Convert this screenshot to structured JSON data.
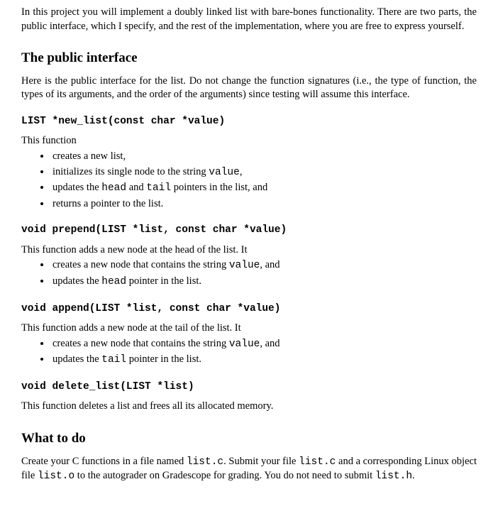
{
  "intro": {
    "p1": "In this project you will implement a doubly linked list with bare-bones functionality. There are two parts, the public interface, which I specify, and the rest of the implementation, where you are free to express yourself."
  },
  "section_public": {
    "heading": "The public interface",
    "p1": "Here is the public interface for the list. Do not change the function signatures (i.e., the type of function, the types of its arguments, and the order of the arguments) since testing will assume this interface."
  },
  "fn_new_list": {
    "sig": "LIST *new_list(const char *value)",
    "lead": "This function",
    "b1": "creates a new list,",
    "b2_pre": "initializes its single node to the string ",
    "b2_code": "value",
    "b2_post": ",",
    "b3_pre": "updates the ",
    "b3_code1": "head",
    "b3_mid": " and ",
    "b3_code2": "tail",
    "b3_post": " pointers in the list, and",
    "b4": "returns a pointer to the list."
  },
  "fn_prepend": {
    "sig": "void prepend(LIST *list, const char *value)",
    "lead": "This function adds a new node at the head of the list. It",
    "b1_pre": "creates a new node that contains the string ",
    "b1_code": "value",
    "b1_post": ", and",
    "b2_pre": "updates the ",
    "b2_code": "head",
    "b2_post": " pointer in the list."
  },
  "fn_append": {
    "sig": "void append(LIST *list, const char *value)",
    "lead": "This function adds a new node at the tail of the list. It",
    "b1_pre": "creates a new node that contains the string ",
    "b1_code": "value",
    "b1_post": ", and",
    "b2_pre": "updates the ",
    "b2_code": "tail",
    "b2_post": " pointer in the list."
  },
  "fn_delete": {
    "sig": "void delete_list(LIST *list)",
    "lead": "This function deletes a list and frees all its allocated memory."
  },
  "section_todo": {
    "heading": "What to do",
    "p1_a": "Create your C functions in a file named ",
    "p1_c1": "list.c",
    "p1_b": ". Submit your file ",
    "p1_c2": "list.c",
    "p1_c": " and a corresponding Linux object file ",
    "p1_c3": "list.o",
    "p1_d": " to the autograder on Gradescope for grading. You do not need to submit ",
    "p1_c4": "list.h",
    "p1_e": "."
  }
}
